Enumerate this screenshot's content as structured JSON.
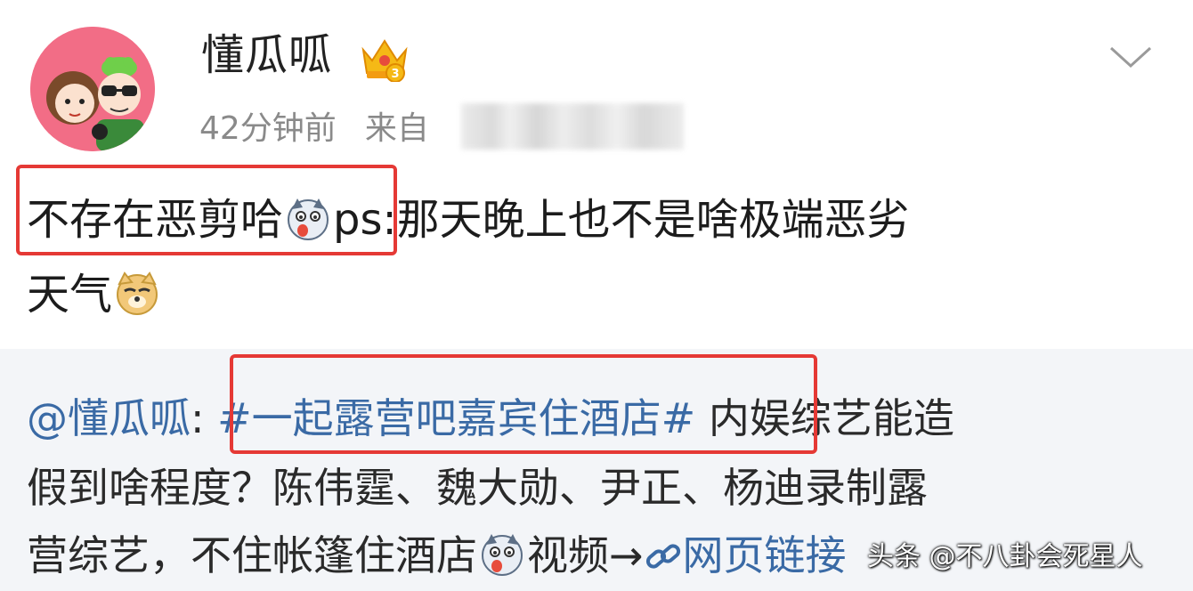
{
  "post": {
    "username": "懂瓜呱",
    "time": "42分钟前",
    "source_prefix": "来自",
    "text_line1_boxed": "不存在恶剪哈",
    "text_line1_rest": "ps:那天晚上也不是啥极端恶劣",
    "text_line2": "天气"
  },
  "repost": {
    "mention": "@懂瓜呱",
    "colon": ":",
    "hashtag": "#一起露营吧嘉宾住酒店#",
    "line1_rest": "内娱综艺能造",
    "line2": "假到啥程度？陈伟霆、魏大勋、尹正、杨迪录制露",
    "line3_text": "营综艺，不住帐篷住酒店",
    "line3_after_emoji": "视频→",
    "link_text": "网页链接"
  },
  "watermark": "头条 @不八卦会死星人",
  "icons": {
    "avatar": "cartoon-couple-avatar",
    "badge": "crown-badge-icon",
    "menu": "chevron-down-icon",
    "emoji_dog": "husky-emoji-icon",
    "emoji_doge": "doge-emoji-icon",
    "link": "link-icon"
  },
  "colors": {
    "link": "#3a6aa5",
    "highlight_box": "#e53935",
    "avatar_bg": "#f26d86",
    "meta_gray": "#8a8a8a"
  }
}
